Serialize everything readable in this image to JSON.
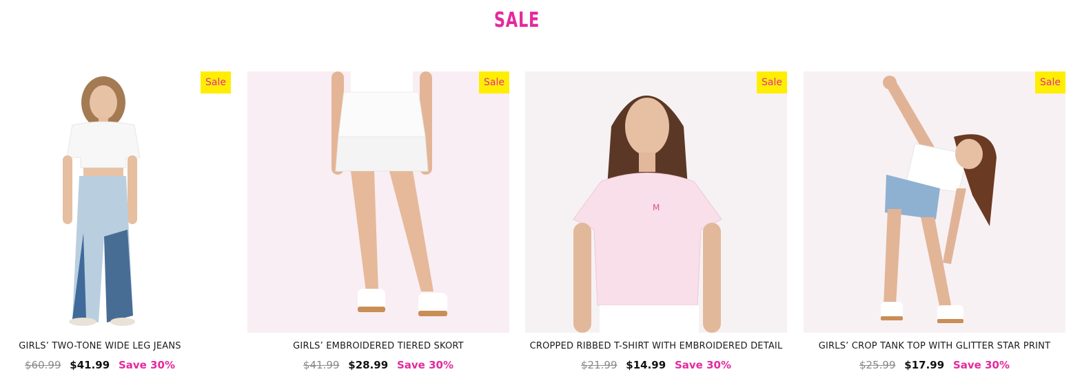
{
  "section": {
    "title": "SALE"
  },
  "colors": {
    "accent": "#e5299d",
    "badge_bg": "#ffee00"
  },
  "products": [
    {
      "badge": "Sale",
      "name": "GIRLS’ TWO-TONE WIDE LEG JEANS",
      "original_price": "$60.99",
      "sale_price": "$41.99",
      "save_text": "Save 30%"
    },
    {
      "badge": "Sale",
      "name": "GIRLS’ EMBROIDERED TIERED SKORT",
      "original_price": "$41.99",
      "sale_price": "$28.99",
      "save_text": "Save 30%"
    },
    {
      "badge": "Sale",
      "name": "CROPPED RIBBED T-SHIRT WITH EMBROIDERED DETAIL",
      "original_price": "$21.99",
      "sale_price": "$14.99",
      "save_text": "Save 30%"
    },
    {
      "badge": "Sale",
      "name": "GIRLS’ CROP TANK TOP WITH GLITTER STAR PRINT",
      "original_price": "$25.99",
      "sale_price": "$17.99",
      "save_text": "Save 30%"
    }
  ]
}
